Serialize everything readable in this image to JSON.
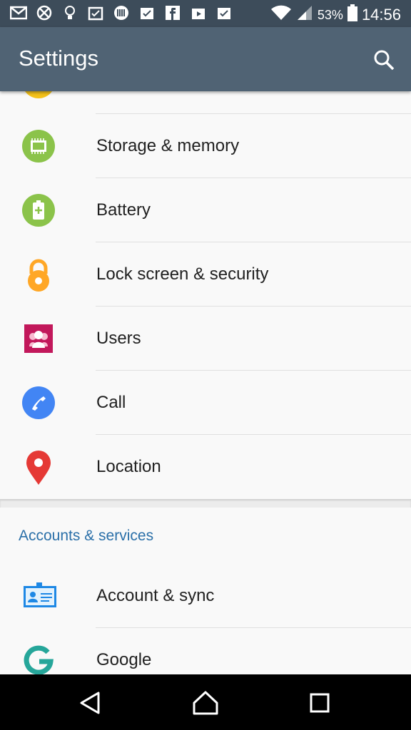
{
  "status_bar": {
    "battery_percent": "53%",
    "time": "14:56",
    "notification_icons": [
      "gmail-icon",
      "cross-app-icon",
      "bulb-icon",
      "calendar-icon",
      "barcode-icon",
      "clipboard-icon",
      "facebook-icon",
      "video-icon",
      "clipboard-check-icon"
    ]
  },
  "app_bar": {
    "title": "Settings",
    "search_icon": "search-icon"
  },
  "items": [
    {
      "label": "Storage & memory",
      "icon": "storage-icon",
      "color": "#8bc34a"
    },
    {
      "label": "Battery",
      "icon": "battery-icon",
      "color": "#8bc34a"
    },
    {
      "label": "Lock screen & security",
      "icon": "lock-icon",
      "color": "#ffa726"
    },
    {
      "label": "Users",
      "icon": "users-icon",
      "color": "#c2185b"
    },
    {
      "label": "Call",
      "icon": "call-icon",
      "color": "#4285f4"
    },
    {
      "label": "Location",
      "icon": "location-pin-icon",
      "color": "#e53935"
    }
  ],
  "accounts_section": {
    "header": "Accounts & services",
    "items": [
      {
        "label": "Account & sync",
        "icon": "account-card-icon",
        "color": "#2196f3"
      },
      {
        "label": "Google",
        "icon": "google-icon",
        "color": "#26a69a"
      }
    ]
  },
  "navigation": {
    "back": "back-icon",
    "home": "home-icon",
    "recents": "recents-icon"
  }
}
